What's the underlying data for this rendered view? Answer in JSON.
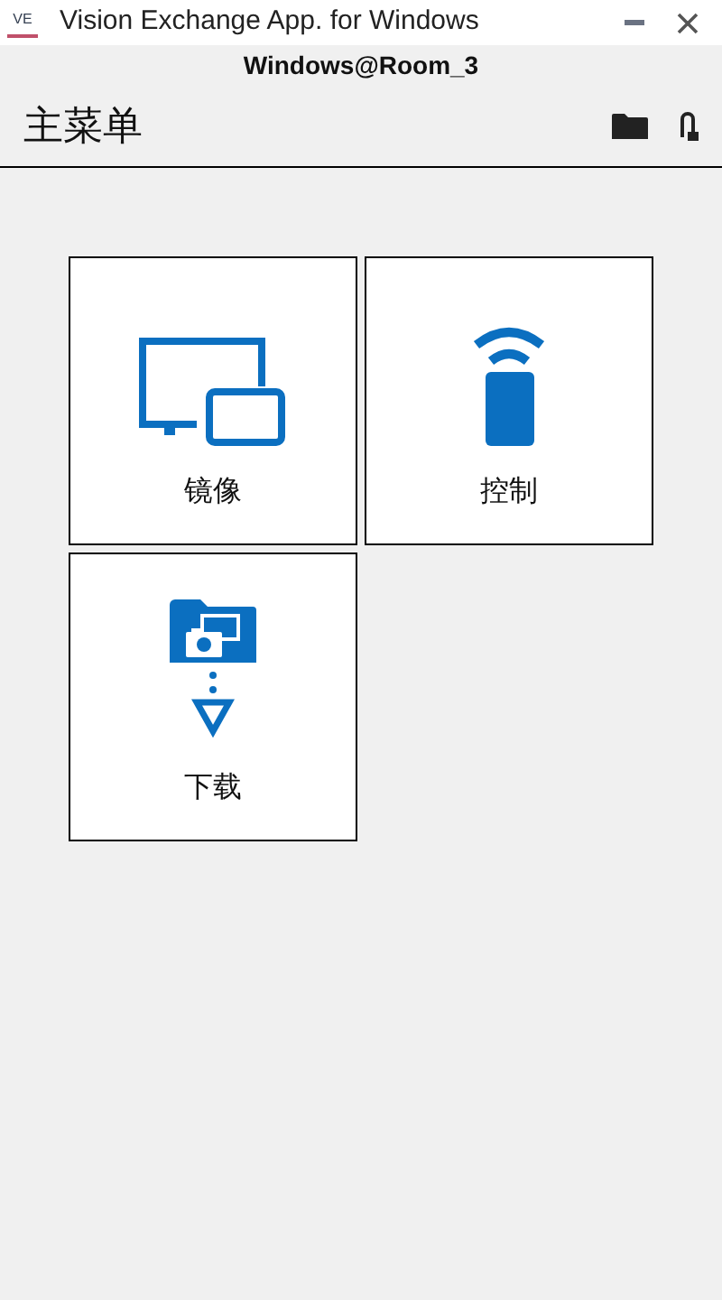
{
  "window": {
    "icon_text": "VE",
    "title": "Vision Exchange App. for Windows"
  },
  "connection": "Windows@Room_3",
  "header": {
    "title": "主菜单"
  },
  "tiles": [
    {
      "kind": "mirror",
      "label": "镜像"
    },
    {
      "kind": "control",
      "label": "控制"
    },
    {
      "kind": "download",
      "label": "下载"
    }
  ]
}
